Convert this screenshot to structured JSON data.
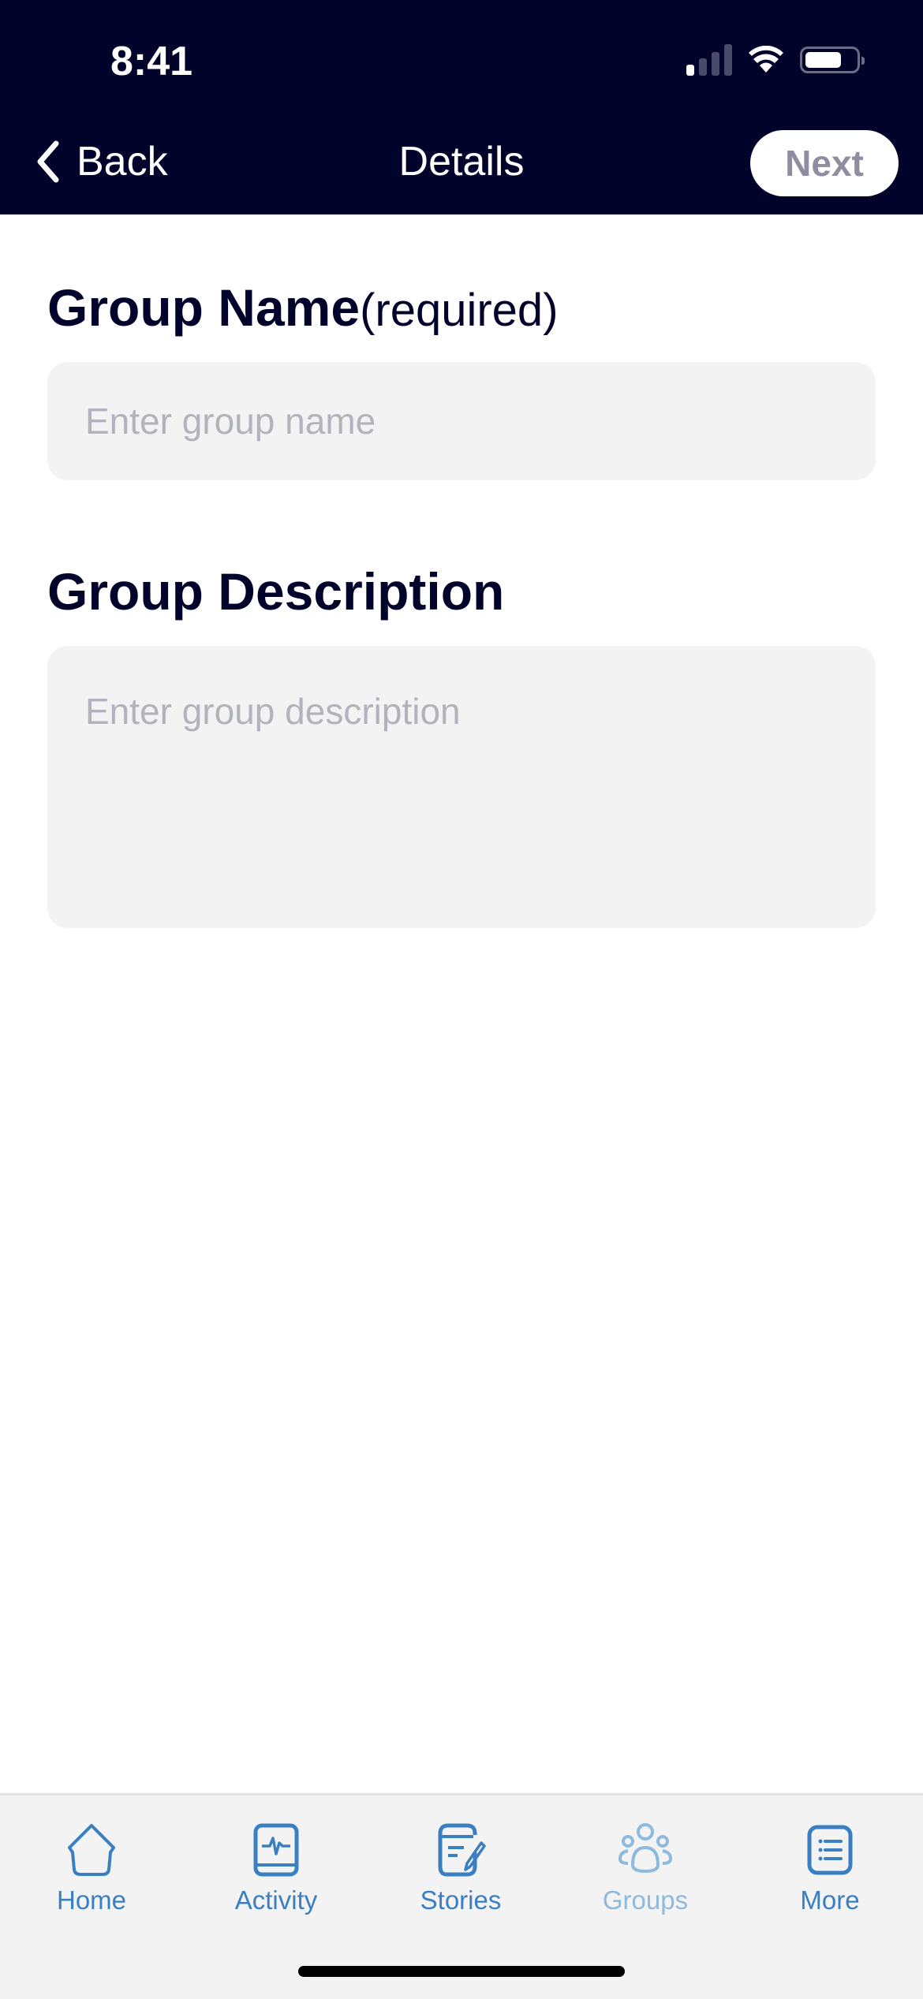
{
  "status_bar": {
    "time": "8:41"
  },
  "nav": {
    "back_label": "Back",
    "title": "Details",
    "next_label": "Next"
  },
  "form": {
    "group_name": {
      "label": "Group Name",
      "required_note": "(required)",
      "placeholder": "Enter group name",
      "value": ""
    },
    "group_description": {
      "label": "Group Description",
      "placeholder": "Enter group description",
      "value": ""
    }
  },
  "tabbar": {
    "items": [
      {
        "label": "Home",
        "icon": "home-icon",
        "active": false
      },
      {
        "label": "Activity",
        "icon": "activity-icon",
        "active": false
      },
      {
        "label": "Stories",
        "icon": "stories-icon",
        "active": false
      },
      {
        "label": "Groups",
        "icon": "groups-icon",
        "active": true
      },
      {
        "label": "More",
        "icon": "more-icon",
        "active": false
      }
    ]
  },
  "colors": {
    "header_bg": "#02032a",
    "accent": "#3a7fc1",
    "active_tab": "#8fb9dd",
    "field_bg": "#f3f3f4"
  }
}
